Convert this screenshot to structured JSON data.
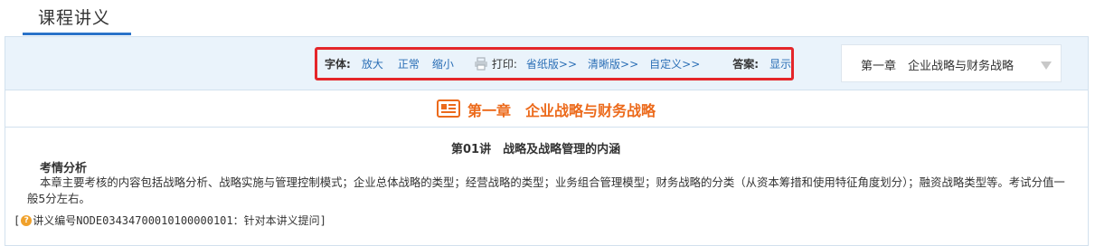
{
  "page": {
    "title": "课程讲义"
  },
  "toolbar": {
    "font_label": "字体:",
    "font_larger": "放大",
    "font_normal": "正常",
    "font_smaller": "缩小",
    "print_label": "打印:",
    "print_paper_saving": "省纸版>>",
    "print_clear": "清晰版>>",
    "print_custom": "自定义>>",
    "answer_label": "答案:",
    "answer_show": "显示"
  },
  "chapter_select": {
    "selected": "第一章　企业战略与财务战略"
  },
  "chapter": {
    "heading": "第一章　企业战略与财务战略"
  },
  "lecture": {
    "title": "第01讲　战略及战略管理的内涵",
    "section_heading": "考情分析",
    "body": "本章主要考核的内容包括战略分析、战略实施与管理控制模式；企业总体战略的类型；经营战略的类型；业务组合管理模型；财务战略的分类（从资本筹措和使用特征角度划分）；融资战略类型等。考试分值一般5分左右。",
    "note_open": "[",
    "note_text": "讲义编号NODE03434700010100000101：针对本讲义提问",
    "note_close": "]"
  },
  "colors": {
    "accent_blue": "#2b73c9",
    "link_blue": "#2b6fb6",
    "highlight_red": "#e4262a",
    "chapter_orange": "#ec6a1b",
    "toolbar_bg": "#eaf3fb"
  },
  "icons": {
    "print": "printer-icon",
    "chapter": "book-list-icon",
    "dropdown": "chevron-down-icon",
    "note": "question-icon"
  }
}
